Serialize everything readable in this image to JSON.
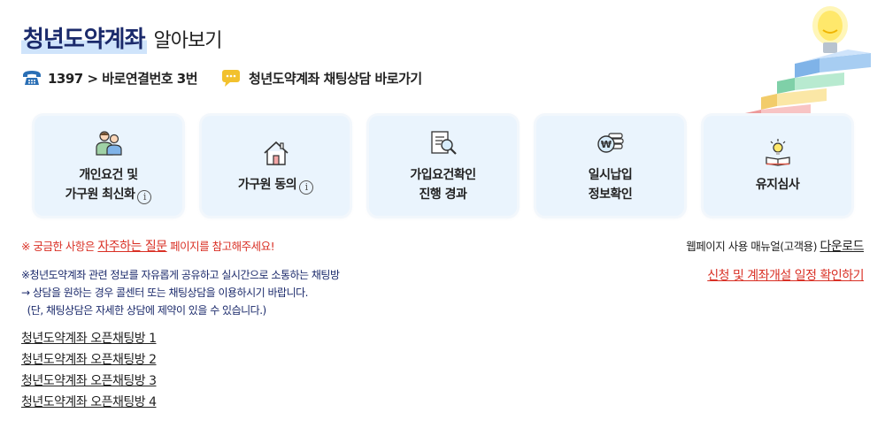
{
  "header": {
    "title_main": "청년도약계좌",
    "title_sub": "알아보기"
  },
  "contact": {
    "phone_text": "1397 > 바로연결번호 3번",
    "chat_text": "청년도약계좌 채팅상담 바로가기",
    "phone_icon": "phone-icon",
    "chat_icon": "chat-bubble-icon"
  },
  "cards": [
    {
      "line1": "개인요건 및",
      "line2": "가구원 최신화",
      "icon": "people-icon",
      "info": "i"
    },
    {
      "line1": "가구원 동의",
      "icon": "house-icon",
      "info": "i"
    },
    {
      "line1": "가입요건확인",
      "line2": "진행 경과",
      "icon": "document-search-icon"
    },
    {
      "line1": "일시납입",
      "line2": "정보확인",
      "icon": "won-coins-icon"
    },
    {
      "line1": "유지심사",
      "icon": "lightbulb-book-icon"
    }
  ],
  "notice": {
    "prefix": "※ 궁금한 사항은 ",
    "link": "자주하는 질문",
    "suffix": " 페이지를 참고해주세요!"
  },
  "manual": {
    "prefix": "웹페이지 사용 매뉴얼(고객용) ",
    "link": "다운로드"
  },
  "schedule_link": "신청 및 계좌개설 일정 확인하기",
  "info_lines": [
    "※청년도약계좌 관련 정보를 자유롭게 공유하고 실시간으로 소통하는 채팅방",
    "→ 상담을 원하는 경우 콜센터 또는 채팅상담을 이용하시기 바랍니다.",
    "  (단, 채팅상담은 자세한 상담에 제약이 있을 수 있습니다.)"
  ],
  "chat_rooms": [
    "청년도약계좌 오픈채팅방 1",
    "청년도약계좌 오픈채팅방 2",
    "청년도약계좌 오픈채팅방 3",
    "청년도약계좌 오픈채팅방 4"
  ],
  "colors": {
    "title": "#1b2a6b",
    "accent_red": "#d93025",
    "card_bg": "#eaf4fd",
    "title_highlight": "#cfe4fb"
  }
}
